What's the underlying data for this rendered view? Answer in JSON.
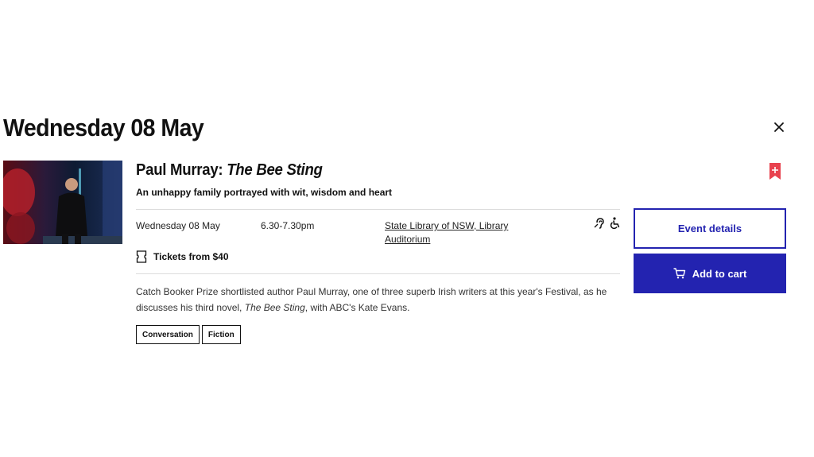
{
  "day": {
    "title": "Wednesday 08 May"
  },
  "event": {
    "title_prefix": "Paul Murray: ",
    "title_italic": "The Bee Sting",
    "subtitle": "An unhappy family portrayed with wit, wisdom and heart",
    "date": "Wednesday 08 May",
    "time": "6.30-7.30pm",
    "venue": "State Library of NSW, Library Auditorium",
    "tickets_label": "Tickets from $40",
    "description": {
      "part1": "Catch Booker Prize shortlisted author Paul Murray, one of three superb Irish writers at this year's Festival, as he discusses his third novel, ",
      "italic": "The Bee Sting",
      "part2": ", with ABC's Kate Evans."
    },
    "tags": [
      "Conversation",
      "Fiction"
    ]
  },
  "actions": {
    "details_label": "Event details",
    "cart_label": "Add to cart"
  },
  "icons": {
    "close": "close-icon",
    "bookmark": "bookmark-add-icon",
    "hearing": "hearing-assist-icon",
    "wheelchair": "wheelchair-access-icon",
    "ticket": "ticket-icon",
    "cart": "cart-icon"
  },
  "colors": {
    "accent": "#2323b0",
    "bookmark": "#e8424e",
    "text": "#111111"
  }
}
